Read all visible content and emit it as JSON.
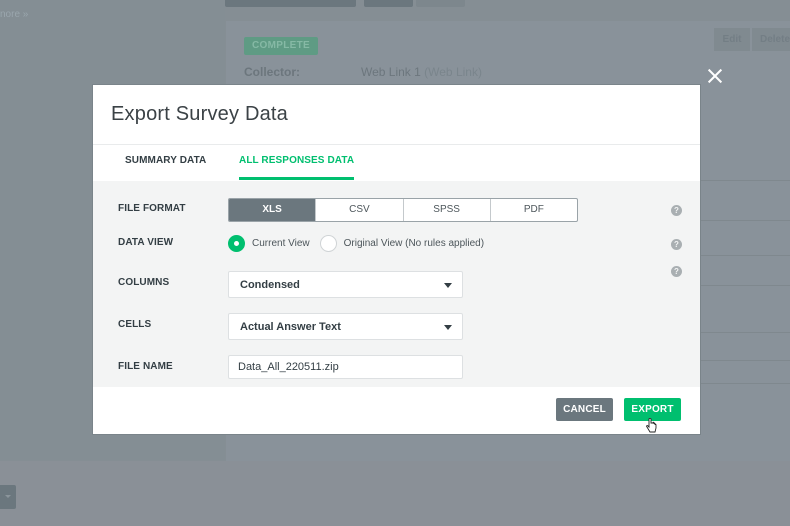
{
  "background": {
    "more_link": "nore »",
    "status_badge": "COMPLETE",
    "collector_label": "Collector:",
    "collector_name": "Web Link 1",
    "collector_type": "(Web Link)",
    "edit_label": "Edit",
    "delete_label": "Delete"
  },
  "modal": {
    "title": "Export Survey Data",
    "close_icon": "close-icon",
    "tabs": [
      {
        "label": "SUMMARY DATA",
        "active": false
      },
      {
        "label": "ALL RESPONSES DATA",
        "active": true
      }
    ],
    "fields": {
      "file_format": {
        "label": "FILE FORMAT",
        "options": [
          "XLS",
          "CSV",
          "SPSS",
          "PDF"
        ],
        "selected": "XLS"
      },
      "data_view": {
        "label": "DATA VIEW",
        "options": [
          "Current View",
          "Original View (No rules applied)"
        ],
        "selected": "Current View"
      },
      "columns": {
        "label": "COLUMNS",
        "value": "Condensed"
      },
      "cells": {
        "label": "CELLS",
        "value": "Actual Answer Text"
      },
      "file_name": {
        "label": "FILE NAME",
        "value": "Data_All_220511.zip"
      }
    },
    "help_icon_glyph": "?",
    "buttons": {
      "cancel": "CANCEL",
      "export": "EXPORT"
    }
  },
  "colors": {
    "accent_green": "#00bf6f",
    "dark_slate": "#6b777e",
    "overlay": "#858e94"
  }
}
